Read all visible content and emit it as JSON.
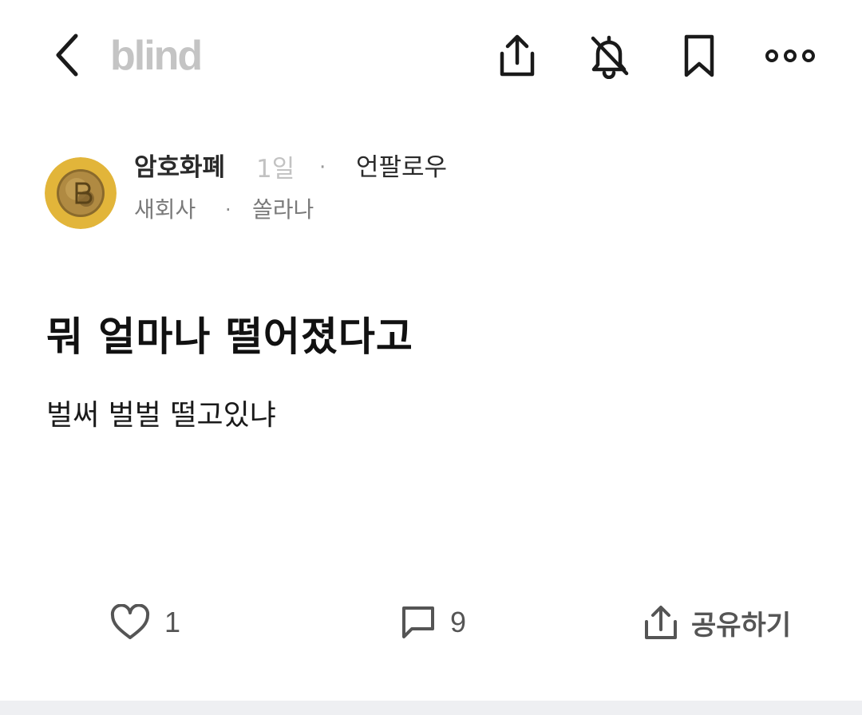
{
  "header": {
    "logo": "blind",
    "icons": [
      "back-icon",
      "share-icon",
      "notification-off-icon",
      "bookmark-icon",
      "more-icon"
    ]
  },
  "author": {
    "name": "암호화폐",
    "time": "1일",
    "separator": "·",
    "unfollow_label": "언팔로우",
    "company": "새회사",
    "nickname": "쏠라나"
  },
  "post": {
    "title": "뭐 얼마나 떨어졌다고",
    "body": "벌써 벌벌 떨고있냐"
  },
  "actions": {
    "like_count": "1",
    "comment_count": "9",
    "share_label": "공유하기"
  },
  "colors": {
    "logo": "#c4c4c4",
    "avatar_bg": "#e2b53a",
    "muted_text": "#7a7a7a",
    "action_icon": "#555555"
  }
}
